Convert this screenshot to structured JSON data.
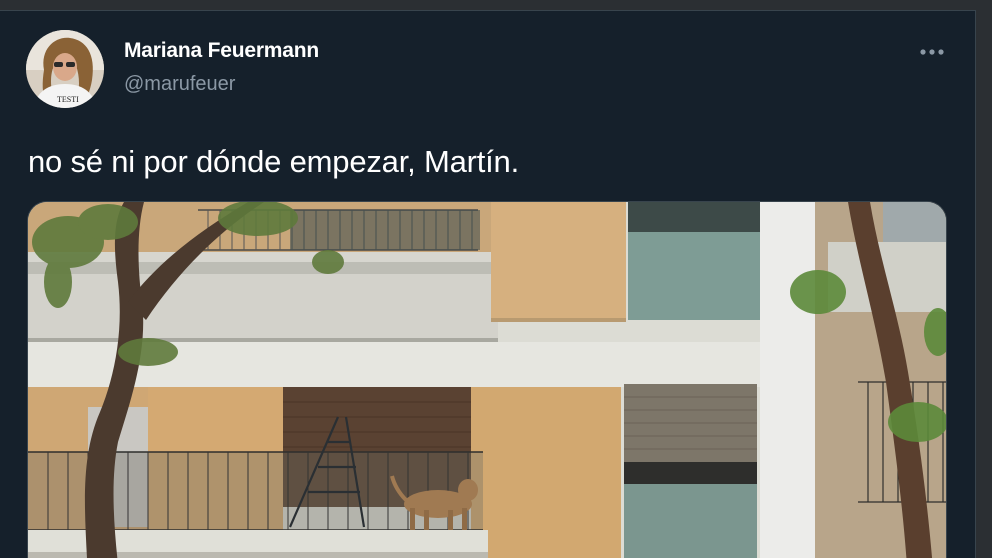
{
  "tweet": {
    "author_name": "Mariana Feuermann",
    "author_handle": "@marufeuer",
    "text": "no sé ni por dónde empezar, Martín.",
    "avatar_shirt_text": "TESTI",
    "more_icon": "more-horizontal-icon",
    "media_description_icon": "photo"
  },
  "colors": {
    "background": "#15202b",
    "outer_background": "#2b2f33",
    "name": "#ffffff",
    "handle": "#8b98a5",
    "border": "#38444d"
  }
}
